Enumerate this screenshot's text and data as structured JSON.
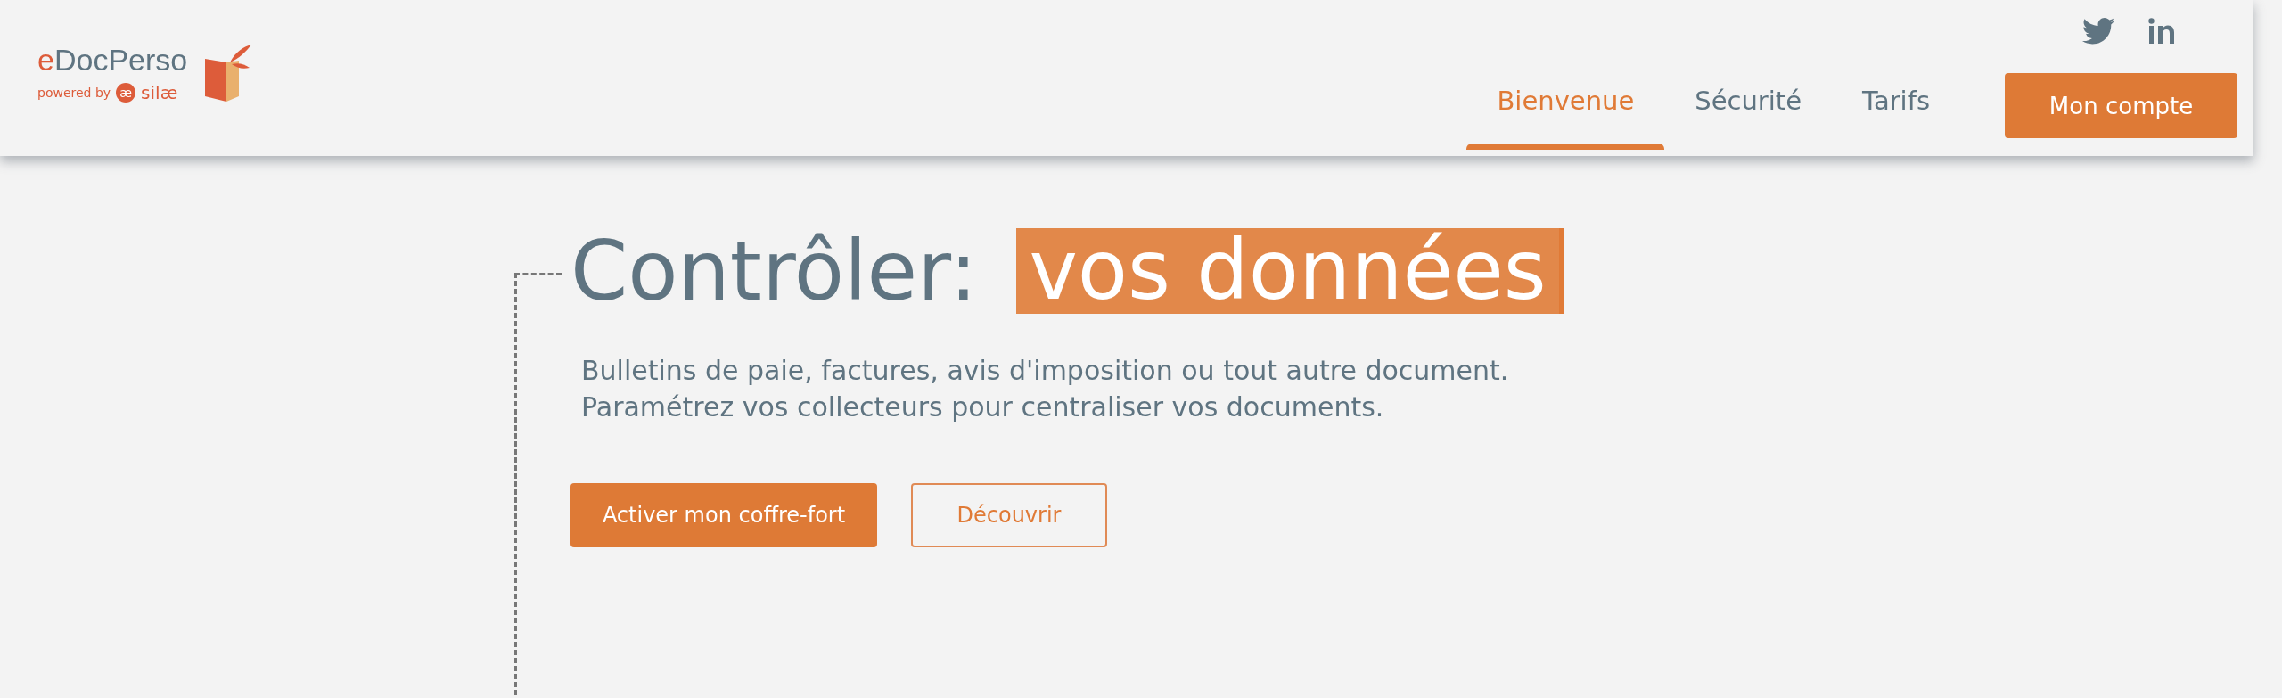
{
  "header": {
    "logo": {
      "accent": "e",
      "name": "DocPerso",
      "powered_by": "powered by",
      "brand_mark": "æ",
      "brand": "silæ"
    },
    "social": [
      {
        "kind": "twitter"
      },
      {
        "kind": "linkedin"
      }
    ],
    "nav": [
      {
        "label": "Bienvenue",
        "selected": true
      },
      {
        "label": "Sécurité",
        "selected": false
      },
      {
        "label": "Tarifs",
        "selected": false
      }
    ],
    "account_button": "Mon compte"
  },
  "hero": {
    "title": "Contrôler:",
    "highlight": "vos données",
    "lines": [
      "Bulletins de paie, factures, avis d'imposition ou tout autre document.",
      "Paramétrez vos collecteurs pour centraliser vos documents."
    ],
    "buttons": [
      {
        "label": "Activer mon coffre-fort",
        "kind": "primary"
      },
      {
        "label": "Découvrir",
        "kind": "outline"
      }
    ]
  }
}
